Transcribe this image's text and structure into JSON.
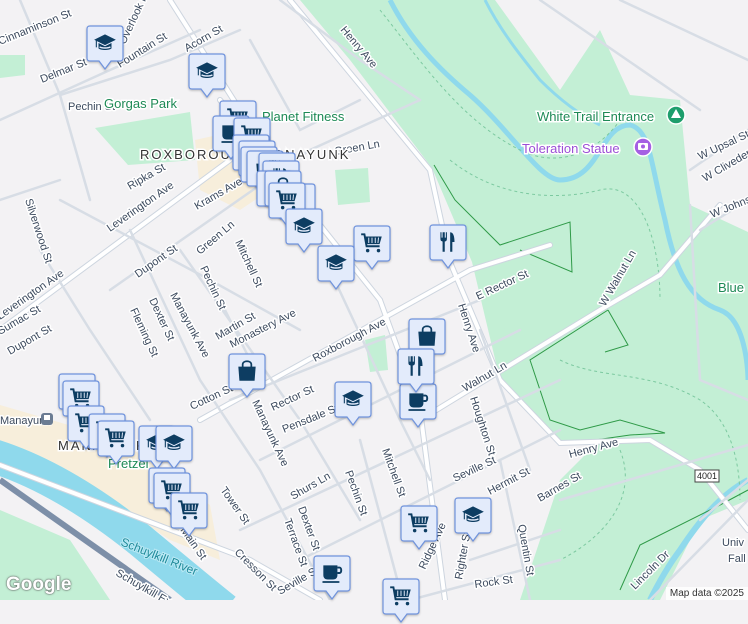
{
  "map": {
    "neighborhoods": [
      "ROXBOROUGH-MANAYUNK",
      "MANAYUNK"
    ],
    "parks": [
      "Gorgas Park",
      "Planet Fitness"
    ],
    "pois": {
      "trail": "White Trail Entrance",
      "statue": "Toleration Statue",
      "station": "Manayunk",
      "blue": "Blue",
      "univ": "Univ",
      "fall": "Fall",
      "pretzel": "Pretzel"
    },
    "water": [
      "Schuylkill River"
    ],
    "route_shield": "4001",
    "streets": {
      "henry_ave": "Henry Ave",
      "henry_ave2": "Henry Ave",
      "henry_ave3": "Henry Ave",
      "cinnaminson": "Cinnaminson St",
      "overlook": "Overlook Rd",
      "fountain": "Fountain St",
      "acorn": "Acorn St",
      "delmar": "Delmar St",
      "ridge_top": "Ridge Ave",
      "pechin1": "Pechin St",
      "ripka": "Ripka St",
      "leverington": "Leverington Ave",
      "krams": "Krams Ave",
      "green_ln": "Green Ln",
      "green_ln2": "Green Ln",
      "mitchell": "Mitchell St",
      "silverwood": "Silverwood St",
      "dupont": "Dupont St",
      "pechin2": "Pechin St",
      "w_upsal": "W Upsal St",
      "w_cliveden": "W Cliveden",
      "w_johnson": "W Johnson",
      "w_walnut": "W Walnut Ln",
      "rector_e": "E Rector St",
      "dexter": "Dexter St",
      "fleming": "Fleming St",
      "manayunk_ave": "Manayunk Ave",
      "martin": "Martin St",
      "monastery": "Monastery Ave",
      "roxborough_ave": "Roxborough Ave",
      "cotton": "Cotton St",
      "rector": "Rector St",
      "pensdale": "Pensdale St",
      "manayunk_ave2": "Manayunk Ave",
      "shurs": "Shurs Ln",
      "pechin3": "Pechin St",
      "tower": "Tower St",
      "main": "Main St",
      "cresson": "Cresson St",
      "terrace": "Terrace St",
      "dexter2": "Dexter St",
      "seville": "Seville St",
      "walnut_ln": "Walnut Ln",
      "houghton": "Houghton St",
      "seville2": "Seville St",
      "hermit": "Hermit St",
      "mitchell2": "Mitchell St",
      "barnes": "Barnes St",
      "ridge_ave": "Ridge Ave",
      "righter": "Righter St",
      "quentin": "Quentin St",
      "rock": "Rock St",
      "lincoln": "Lincoln Dr",
      "schuylkill_expy": "Schuylkill Expy",
      "dupont2": "Dupont St",
      "leverington2": "Leverington Ave",
      "hamilton": "Sumac St"
    },
    "markers": [
      {
        "icon": "school"
      },
      {
        "icon": "school"
      },
      {
        "icon": "cart"
      },
      {
        "icon": "cafe"
      },
      {
        "icon": "cart"
      },
      {
        "icon": "bag"
      },
      {
        "icon": "bag"
      },
      {
        "icon": "bag"
      },
      {
        "icon": "bag"
      },
      {
        "icon": "restaurant"
      },
      {
        "icon": "restaurant"
      },
      {
        "icon": "cafe"
      },
      {
        "icon": "bag"
      },
      {
        "icon": "restaurant"
      },
      {
        "icon": "cart"
      },
      {
        "icon": "school"
      },
      {
        "icon": "restaurant"
      },
      {
        "icon": "restaurant"
      },
      {
        "icon": "cafe"
      },
      {
        "icon": "bag"
      },
      {
        "icon": "restaurant"
      },
      {
        "icon": "cafe"
      },
      {
        "icon": "bag"
      },
      {
        "icon": "school"
      },
      {
        "icon": "cart"
      },
      {
        "icon": "cart"
      },
      {
        "icon": "cart"
      },
      {
        "icon": "cart"
      },
      {
        "icon": "cart"
      },
      {
        "icon": "school"
      },
      {
        "icon": "school"
      },
      {
        "icon": "cart"
      },
      {
        "icon": "cart"
      },
      {
        "icon": "cart"
      },
      {
        "icon": "cart"
      },
      {
        "icon": "school"
      },
      {
        "icon": "cafe"
      },
      {
        "icon": "cart"
      }
    ],
    "attribution": "Map data ©2025",
    "logo": "Google"
  },
  "colors": {
    "park": "#c3efd5",
    "water": "#8fd9ec",
    "road": "#ffffff",
    "marker_fill": "#e3ebfb",
    "marker_border": "#6f93dd",
    "icon": "#0d3d62"
  }
}
